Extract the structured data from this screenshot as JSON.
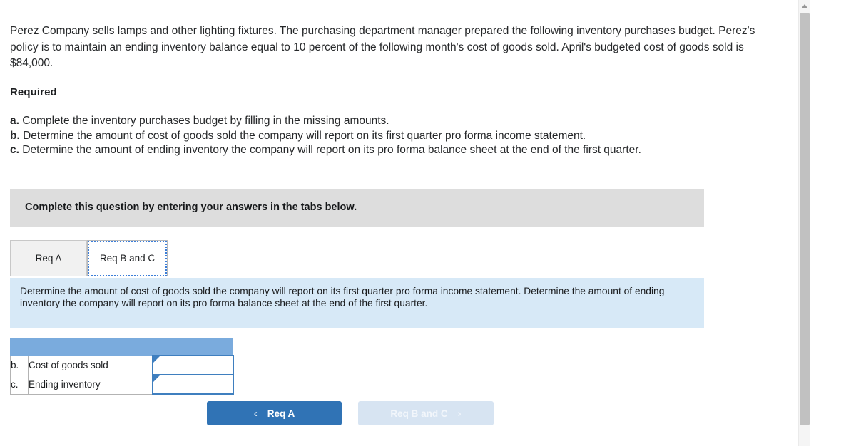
{
  "problem": {
    "intro": "Perez Company sells lamps and other lighting fixtures. The purchasing department manager prepared the following inventory purchases budget. Perez's policy is to maintain an ending inventory balance equal to 10 percent of the following month's cost of goods sold. April's budgeted cost of goods sold is $84,000.",
    "required_heading": "Required",
    "requirements": [
      {
        "letter": "a.",
        "text": "Complete the inventory purchases budget by filling in the missing amounts."
      },
      {
        "letter": "b.",
        "text": "Determine the amount of cost of goods sold the company will report on its first quarter pro forma income statement."
      },
      {
        "letter": "c.",
        "text": "Determine the amount of ending inventory the company will report on its pro forma balance sheet at the end of the first quarter."
      }
    ]
  },
  "banner": {
    "text": "Complete this question by entering your answers in the tabs below."
  },
  "tabs": [
    {
      "label": "Req A",
      "active": false
    },
    {
      "label": "Req B and C",
      "active": true
    }
  ],
  "panel": {
    "text": "Determine the amount of cost of goods sold the company will report on its first quarter pro forma income statement. Determine the amount of ending inventory the company will report on its pro forma balance sheet at the end of the first quarter."
  },
  "answer_table": {
    "header_color": "#7aabdd",
    "header_cells": [
      "",
      "",
      ""
    ],
    "rows": [
      {
        "letter": "b.",
        "label": "Cost of goods sold",
        "value": "",
        "placeholder": ""
      },
      {
        "letter": "c.",
        "label": "Ending inventory",
        "value": "",
        "placeholder": ""
      }
    ]
  },
  "nav": {
    "prev_label": "Req A",
    "prev_icon": "chevron-left",
    "prev_glyph": "‹",
    "next_label": "Req B and C",
    "next_icon": "chevron-right",
    "next_glyph": "›",
    "prev_color": "#3073b5",
    "next_color": "#d7e4f2"
  },
  "scrollbar": {
    "up_arrow_icon": "triangle-up-icon",
    "position_percent": 0
  }
}
